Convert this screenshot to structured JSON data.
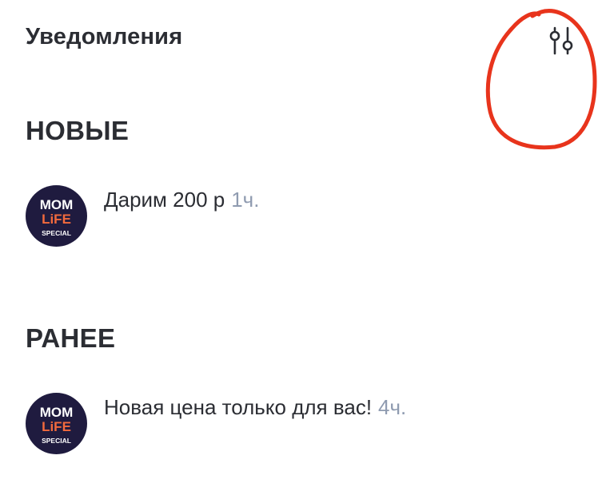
{
  "header": {
    "title": "Уведомления",
    "filter_icon": "sliders-icon"
  },
  "sections": [
    {
      "heading": "НОВЫЕ",
      "items": [
        {
          "text": "Дарим 200 р",
          "time": "1ч.",
          "avatar": {
            "line1": "MOM",
            "line2": "LiFE",
            "line3": "SPECIAL"
          }
        }
      ]
    },
    {
      "heading": "РАНЕЕ",
      "items": [
        {
          "text": "Новая цена только для вас!",
          "time": "4ч.",
          "avatar": {
            "line1": "MOM",
            "line2": "LiFE",
            "line3": "SPECIAL"
          }
        }
      ]
    }
  ],
  "colors": {
    "text": "#2b2d33",
    "time": "#8f9bb0",
    "avatar_bg": "#1f1b3f",
    "avatar_accent": "#f26a3d",
    "annotation": "#e8341c"
  }
}
